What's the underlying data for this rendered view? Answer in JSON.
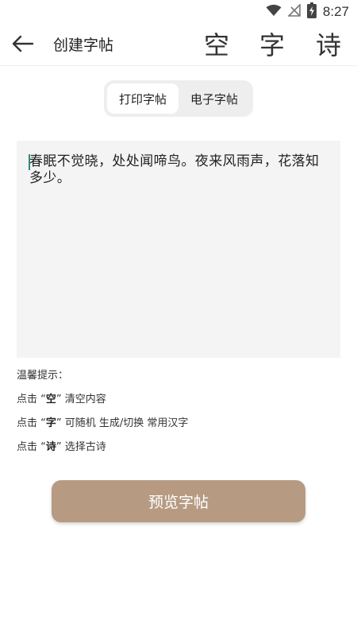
{
  "status_bar": {
    "time": "8:27",
    "icons": [
      "wifi-icon",
      "no-signal-icon",
      "battery-charging-icon"
    ]
  },
  "app_bar": {
    "back_icon": "arrow-left-icon",
    "title": "创建字帖",
    "actions": [
      "空",
      "字",
      "诗"
    ]
  },
  "mode_toggle": {
    "print": "打印字帖",
    "ebook": "电子字帖",
    "selected": "打印字帖"
  },
  "editor": {
    "text": "春眠不觉晓，处处闻啼鸟。夜来风雨声，花落知多少。",
    "caret_color": "#2e8b80"
  },
  "tips": {
    "heading": "温馨提示：",
    "line1": {
      "prefix": "点击 “",
      "key": "空",
      "suffix": "” 清空内容"
    },
    "line2": {
      "prefix": "点击 “",
      "key": "字",
      "suffix": "” 可随机 生成/切换 常用汉字"
    },
    "line3": {
      "prefix": "点击 “",
      "key": "诗",
      "suffix": "” 选择古诗"
    }
  },
  "preview_button": {
    "label": "预览字帖",
    "color": "#b69b82"
  }
}
